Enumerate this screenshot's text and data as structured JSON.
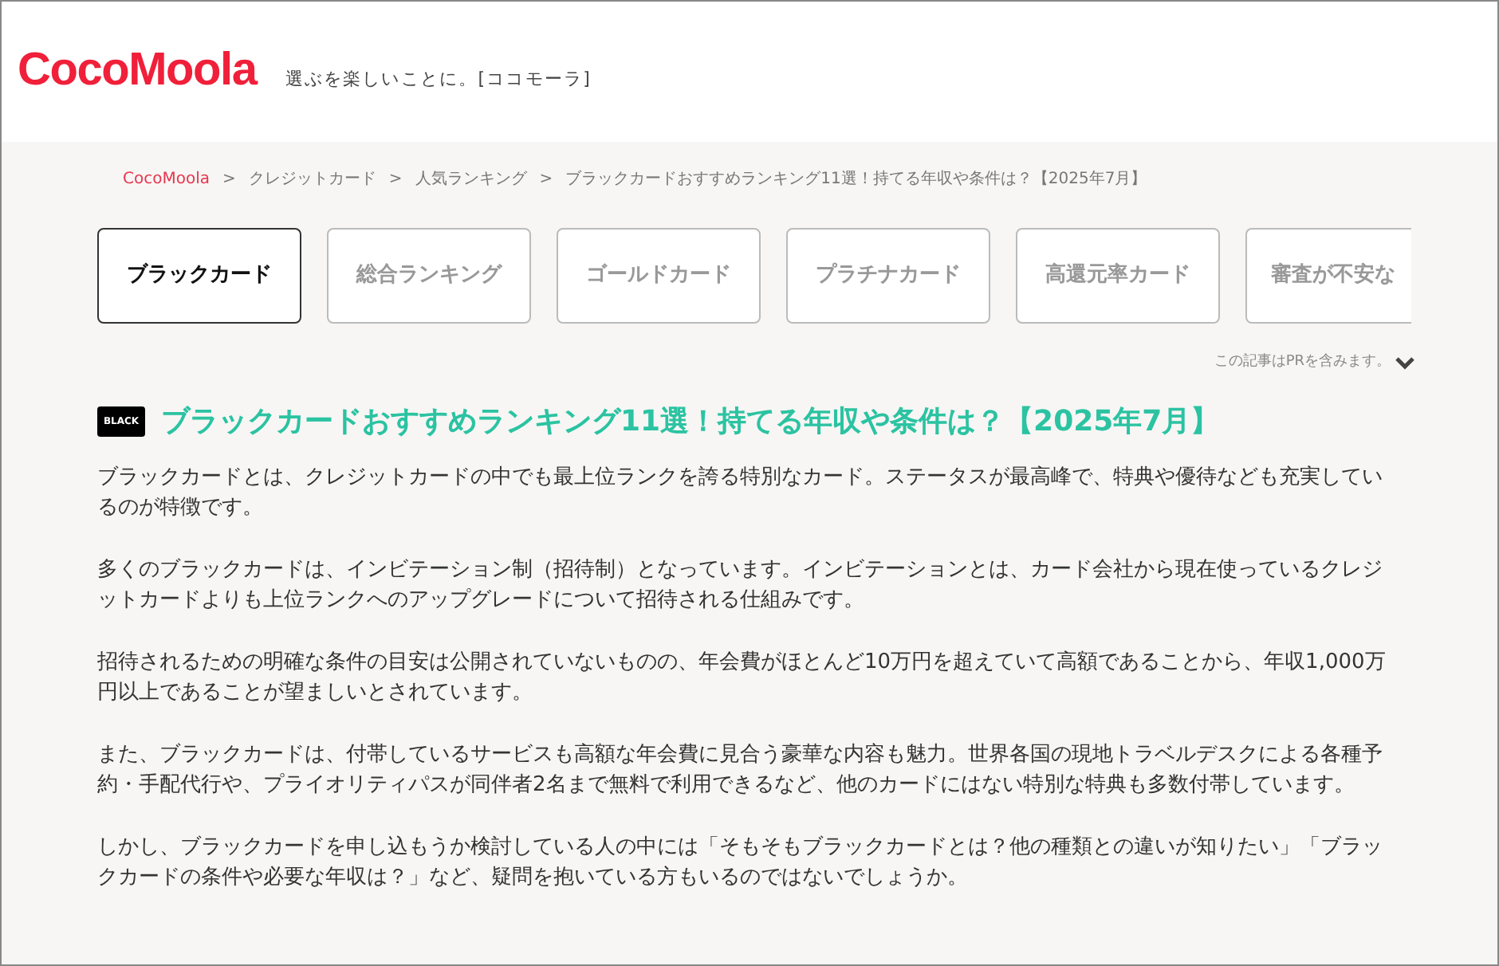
{
  "header": {
    "logo": "CocoMoola",
    "tagline": "選ぶを楽しいことに。[ココモーラ]"
  },
  "breadcrumb": [
    {
      "label": "CocoMoola",
      "link": true
    },
    {
      "label": "クレジットカード",
      "link": false
    },
    {
      "label": "人気ランキング",
      "link": false
    },
    {
      "label": "ブラックカードおすすめランキング11選！持てる年収や条件は？【2025年7月】",
      "link": false
    }
  ],
  "breadcrumb_separator": ">",
  "tabs": [
    {
      "label": "ブラックカード",
      "selected": true
    },
    {
      "label": "総合ランキング",
      "selected": false
    },
    {
      "label": "ゴールドカード",
      "selected": false
    },
    {
      "label": "プラチナカード",
      "selected": false
    },
    {
      "label": "高還元率カード",
      "selected": false
    },
    {
      "label": "審査が不安な",
      "selected": false
    }
  ],
  "pr_notice": "この記事はPRを含みます。",
  "article": {
    "badge": "BLACK",
    "title": "ブラックカードおすすめランキング11選！持てる年収や条件は？【2025年7月】",
    "paragraphs": [
      "ブラックカードとは、クレジットカードの中でも最上位ランクを誇る特別なカード。ステータスが最高峰で、特典や優待なども充実しているのが特徴です。",
      "多くのブラックカードは、インビテーション制（招待制）となっています。インビテーションとは、カード会社から現在使っているクレジットカードよりも上位ランクへのアップグレードについて招待される仕組みです。",
      "招待されるための明確な条件の目安は公開されていないものの、年会費がほとんど10万円を超えていて高額であることから、年収1,000万円以上であることが望ましいとされています。",
      "また、ブラックカードは、付帯しているサービスも高額な年会費に見合う豪華な内容も魅力。世界各国の現地トラベルデスクによる各種予約・手配代行や、プライオリティパスが同伴者2名まで無料で利用できるなど、他のカードにはない特別な特典も多数付帯しています。",
      "しかし、ブラックカードを申し込もうか検討している人の中には「そもそもブラックカードとは？他の種類との違いが知りたい」「ブラックカードの条件や必要な年収は？」など、疑問を抱いている方もいるのではないでしょうか。"
    ]
  }
}
